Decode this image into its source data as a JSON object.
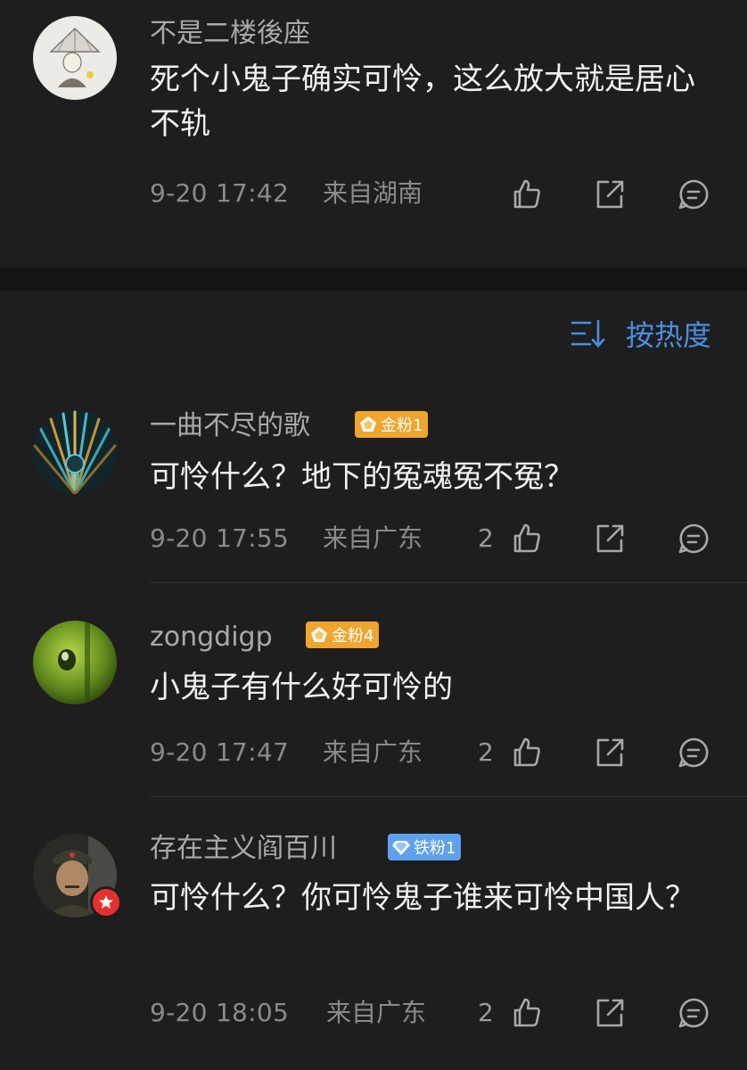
{
  "top_comment": {
    "username": "不是二楼後座",
    "content": "死个小鬼子确实可怜，这么放大就是居心不轨",
    "time": "9-20 17:42",
    "location": "来自湖南"
  },
  "sort": {
    "label": "按热度",
    "icon": "sort-icon"
  },
  "comments": [
    {
      "username": "一曲不尽的歌",
      "badge": "金粉1",
      "badge_color": "#f0a52e",
      "content": "可怜什么？地下的冤魂冤不冤？",
      "time": "9-20 17:55",
      "location": "来自广东",
      "likes": "2"
    },
    {
      "username": "zongdigp",
      "badge": "金粉4",
      "badge_color": "#f0a52e",
      "content": "小鬼子有什么好可怜的",
      "time": "9-20 17:47",
      "location": "来自广东",
      "likes": "2"
    },
    {
      "username": "存在主义阎百川",
      "badge": "铁粉1",
      "badge_color": "#5fa1ef",
      "content": "可怜什么？你可怜鬼子谁来可怜中国人？",
      "time": "9-20 18:05",
      "location": "来自广东",
      "likes": "2"
    }
  ],
  "colors": {
    "background": "#1e1e1e",
    "accent": "#4a8fe0",
    "text": "#f1f1f1",
    "secondary": "#8a8a8a"
  }
}
